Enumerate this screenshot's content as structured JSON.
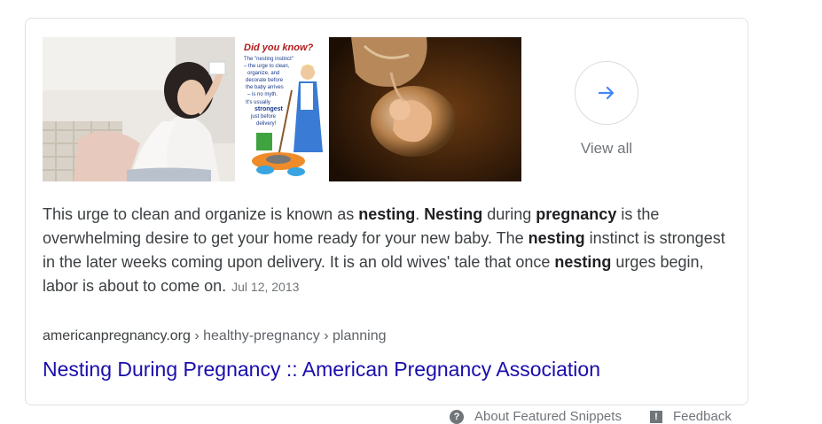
{
  "images": [
    {
      "alt": "woman-cleaning-window-photo"
    },
    {
      "alt": "did-you-know-nesting-cartoon",
      "heading": "Did you know?",
      "lines": [
        "The \"nesting instinct\"",
        "– the urge to clean,",
        "organize, and",
        "decorate before",
        "the baby arrives",
        "– is no myth.",
        "It's usually",
        "strongest",
        "just before",
        "delivery!"
      ]
    },
    {
      "alt": "fetus-in-amniotic-sac-photo"
    }
  ],
  "view_all": {
    "label": "View all",
    "icon": "arrow-right-icon"
  },
  "snippet": {
    "parts": [
      {
        "text": "This urge to clean and organize is known as ",
        "bold": false
      },
      {
        "text": "nesting",
        "bold": true
      },
      {
        "text": ". ",
        "bold": false
      },
      {
        "text": "Nesting",
        "bold": true
      },
      {
        "text": " during ",
        "bold": false
      },
      {
        "text": "pregnancy",
        "bold": true
      },
      {
        "text": " is the overwhelming desire to get your home ready for your new baby. The ",
        "bold": false
      },
      {
        "text": "nesting",
        "bold": true
      },
      {
        "text": " instinct is strongest in the later weeks coming upon delivery. It is an old wives' tale that once ",
        "bold": false
      },
      {
        "text": "nesting",
        "bold": true
      },
      {
        "text": " urges begin, labor is about to come on.",
        "bold": false
      }
    ],
    "date": "Jul 12, 2013"
  },
  "source": {
    "domain": "americanpregnancy.org",
    "path": " › healthy-pregnancy › planning"
  },
  "result_title": "Nesting During Pregnancy :: American Pregnancy Association",
  "footer": {
    "about": "About Featured Snippets",
    "feedback": "Feedback"
  },
  "colors": {
    "link": "#1a0dab",
    "arrow": "#4285f4",
    "border": "#dfe1e5"
  }
}
